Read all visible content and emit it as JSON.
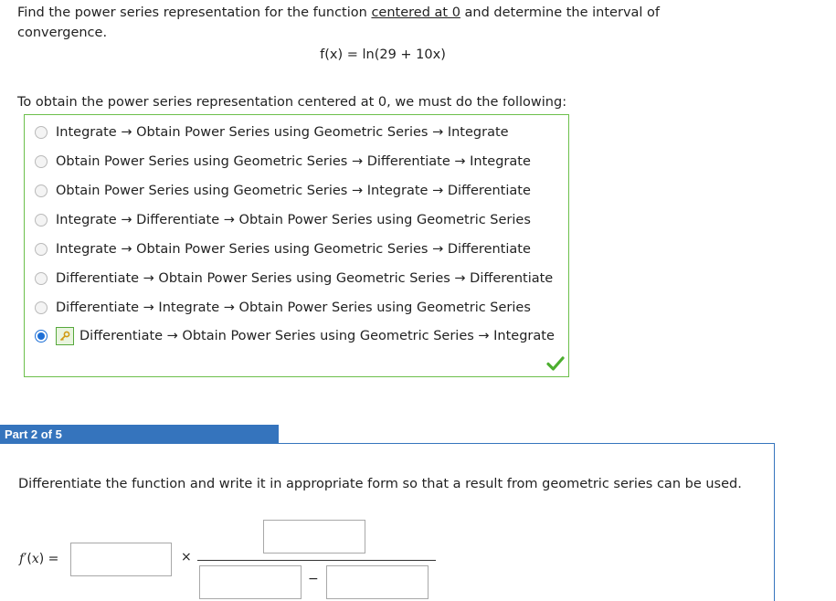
{
  "question": {
    "prefix": "Find the power series representation for the function",
    "link_text": "centered at 0",
    "suffix": "and determine the interval of",
    "line2": "convergence.",
    "function": "f(x) = ln(29 + 10x)"
  },
  "part1": {
    "instruction": "To obtain the power series representation centered at 0, we must do the following:",
    "options": [
      {
        "label": "Integrate → Obtain Power Series using Geometric Series → Integrate",
        "selected": false
      },
      {
        "label": "Obtain Power Series using Geometric Series → Differentiate → Integrate",
        "selected": false
      },
      {
        "label": "Obtain Power Series using Geometric Series → Integrate → Differentiate",
        "selected": false
      },
      {
        "label": "Integrate → Differentiate → Obtain Power Series using Geometric Series",
        "selected": false
      },
      {
        "label": "Integrate → Obtain Power Series using Geometric Series → Differentiate",
        "selected": false
      },
      {
        "label": "Differentiate → Obtain Power Series using Geometric Series → Differentiate",
        "selected": false
      },
      {
        "label": "Differentiate → Integrate → Obtain Power Series using Geometric Series",
        "selected": false
      },
      {
        "label": "Differentiate → Obtain Power Series using Geometric Series → Integrate",
        "selected": true
      }
    ],
    "status_icon": "checkmark-icon"
  },
  "part2": {
    "header": "Part 2 of 5",
    "instruction": "Differentiate the function and write it in appropriate form so that a result from geometric series can be used.",
    "fprime_label": "f'(x) =",
    "times_symbol": "×",
    "minus_symbol": "−",
    "inputs": {
      "coefficient": "",
      "numerator": "",
      "denominator_left": "",
      "denominator_right": ""
    }
  },
  "colors": {
    "correct_border": "#6cbf4b",
    "part_header_bg": "#3574bd",
    "radio_selected": "#1d6fd6",
    "check_green": "#4cae2f"
  }
}
